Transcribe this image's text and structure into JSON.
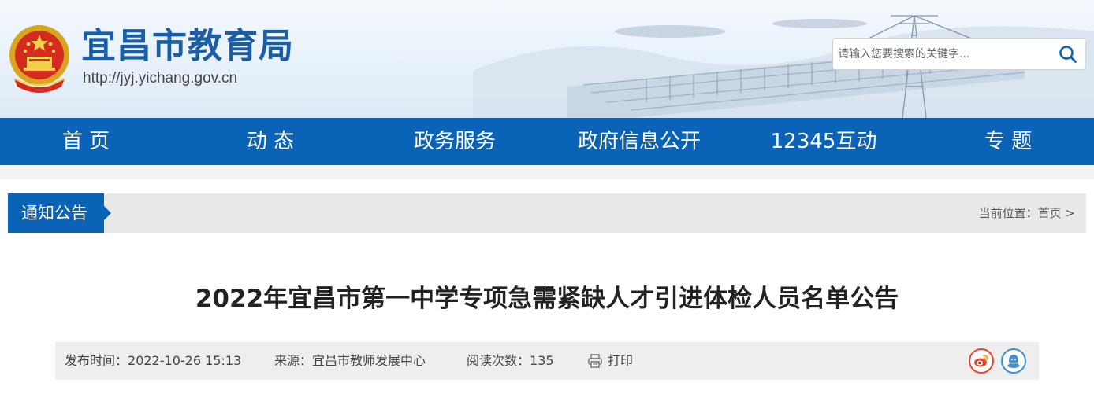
{
  "header": {
    "site_title": "宜昌市教育局",
    "site_url": "http://jyj.yichang.gov.cn",
    "emblem_icon": "national-emblem-icon"
  },
  "search": {
    "placeholder": "请输入您要搜索的关键字...",
    "value": "",
    "button_icon": "search-icon"
  },
  "nav": {
    "items": [
      {
        "label": "首 页"
      },
      {
        "label": "动 态"
      },
      {
        "label": "政务服务"
      },
      {
        "label": "政府信息公开"
      },
      {
        "label": "12345互动"
      },
      {
        "label": "专 题"
      }
    ]
  },
  "breadcrumb": {
    "section_label": "通知公告",
    "location_prefix": "当前位置：",
    "home_link": "首页",
    "separator": ">"
  },
  "article": {
    "title": "2022年宜昌市第一中学专项急需紧缺人才引进体检人员名单公告",
    "publish_time_label": "发布时间：",
    "publish_time": "2022-10-26 15:13",
    "source_label": "来源：",
    "source": "宜昌市教师发展中心",
    "views_label": "阅读次数：",
    "views": "135",
    "print_label": "打印",
    "print_icon": "printer-icon",
    "share": [
      {
        "icon": "weibo-icon",
        "color": "#e8462b"
      },
      {
        "icon": "qq-icon",
        "color": "#3a8fe0"
      }
    ]
  },
  "colors": {
    "primary_blue": "#0b63b8",
    "title_blue": "#1a5ea8",
    "bar_gray": "#e9e9e9"
  }
}
